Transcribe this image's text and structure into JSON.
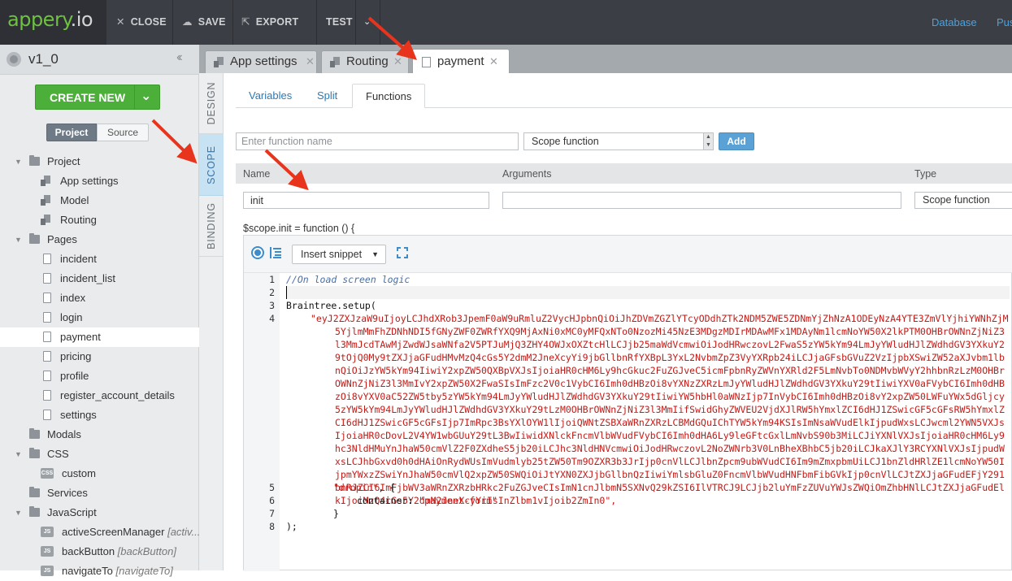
{
  "app": {
    "logo_main": "appery",
    "logo_suffix": ".io"
  },
  "toolbar": {
    "close_label": "CLOSE",
    "save_label": "SAVE",
    "export_label": "EXPORT",
    "test_label": "TEST",
    "database_link": "Database",
    "push_link": "Pus"
  },
  "project": {
    "name": "v1_0",
    "create_new_label": "CREATE NEW",
    "view_tabs": [
      "Project",
      "Source"
    ],
    "active_view": "Project"
  },
  "tree": [
    {
      "label": "Project",
      "type": "folder",
      "level": 0,
      "expanded": true
    },
    {
      "label": "App settings",
      "type": "config",
      "level": 1
    },
    {
      "label": "Model",
      "type": "config",
      "level": 1
    },
    {
      "label": "Routing",
      "type": "config",
      "level": 1
    },
    {
      "label": "Pages",
      "type": "folder",
      "level": 0,
      "expanded": true
    },
    {
      "label": "incident",
      "type": "page",
      "level": 1
    },
    {
      "label": "incident_list",
      "type": "page",
      "level": 1
    },
    {
      "label": "index",
      "type": "page",
      "level": 1
    },
    {
      "label": "login",
      "type": "page",
      "level": 1
    },
    {
      "label": "payment",
      "type": "page",
      "level": 1,
      "selected": true
    },
    {
      "label": "pricing",
      "type": "page",
      "level": 1
    },
    {
      "label": "profile",
      "type": "page",
      "level": 1
    },
    {
      "label": "register_account_details",
      "type": "page",
      "level": 1
    },
    {
      "label": "settings",
      "type": "page",
      "level": 1
    },
    {
      "label": "Modals",
      "type": "folder",
      "level": 0,
      "expanded": false
    },
    {
      "label": "CSS",
      "type": "folder",
      "level": 0,
      "expanded": true
    },
    {
      "label": "custom",
      "type": "css",
      "level": 1
    },
    {
      "label": "Services",
      "type": "folder",
      "level": 0,
      "expanded": false
    },
    {
      "label": "JavaScript",
      "type": "folder",
      "level": 0,
      "expanded": true
    },
    {
      "label": "activeScreenManager",
      "suffix": "[activ...",
      "type": "js",
      "level": 1
    },
    {
      "label": "backButton",
      "suffix": "[backButton]",
      "type": "js",
      "level": 1
    },
    {
      "label": "navigateTo",
      "suffix": "[navigateTo]",
      "type": "js",
      "level": 1
    }
  ],
  "vertical_tabs": [
    "DESIGN",
    "SCOPE",
    "BINDING"
  ],
  "active_vertical_tab": "SCOPE",
  "editor_tabs": [
    {
      "label": "App settings",
      "active": false
    },
    {
      "label": "Routing",
      "active": false
    },
    {
      "label": "payment",
      "active": true
    }
  ],
  "sub_tabs": [
    "Variables",
    "Split",
    "Functions"
  ],
  "active_sub_tab": "Functions",
  "new_function": {
    "name_placeholder": "Enter function name",
    "scope_value": "Scope function",
    "add_label": "Add"
  },
  "table": {
    "headers": [
      "Name",
      "Arguments",
      "Type"
    ],
    "row": {
      "name": "init",
      "arguments": "",
      "type": "Scope function"
    }
  },
  "signature": "$scope.init = function () {",
  "code_toolbar": {
    "snippet_label": "Insert snippet"
  },
  "code": {
    "line_numbers": [
      "1",
      "2",
      "3",
      "4",
      "5",
      "6",
      "7",
      "8"
    ],
    "line1": "//On load screen logic",
    "line3": "Braintree.setup(",
    "token": "\"eyJ2ZXJzaW9uIjoyLCJhdXRob3JpemF0aW9uRmluZ2VycHJpbnQiOiJhZDVmZGZlYTcyODdhZTk2NDM5ZWE5ZDNmYjZhNzA1ODEyNzA4YTE3ZmVlYjhiYWNhZjM5YjlmMmFhZDNhNDI5fGNyZWF0ZWRfYXQ9MjAxNi0xMC0yMFQxNTo0NzozMi45NzE3MDgzMDIrMDAwMFx1MDAyNm1lcmNoYW50X2lkPTM0OHBrOWNnZjNiZ3l3MmJcdTAwMjZwdWJsaWNfa2V5PTJuMjQ3ZHY4OWJxOXZtcHlLCJjb25maWdVcmwiOiJodHRwczovL2FwaS5zYW5kYm94LmJyYWludHJlZWdhdGV3YXkuY29tOjQ0My9tZXJjaGFudHMvMzQ4cGs5Y2dmM2JneXcyYi9jbGllbnRfYXBpL3YxL2NvbmZpZ3VyYXRpb24iLCJjaGFsbGVuZ2VzIjpbXSwiZW52aXJvbm1lbnQiOiJzYW5kYm94IiwiY2xpZW50QXBpVXJsIjoiaHR0cHM6Ly9hcGkuc2FuZGJveC5icmFpbnRyZWVnYXRld2F5LmNvbTo0NDMvbWVyY2hhbnRzLzM0OHBrOWNnZjNiZ3l3MmIvY2xpZW50X2FwaSIsImFzc2V0c1VybCI6Imh0dHBzOi8vYXNzZXRzLmJyYWludHJlZWdhdGV3YXkuY29tIiwiYXV0aFVybCI6Imh0dHBzOi8vYXV0aC52ZW5tby5zYW5kYm94LmJyYWludHJlZWdhdGV3YXkuY29tIiwiYW5hbHl0aWNzIjp7InVybCI6Imh0dHBzOi8vY2xpZW50LWFuYWx5dGljcy5zYW5kYm94LmJyYWludHJlZWdhdGV3YXkuY29tLzM0OHBrOWNnZjNiZ3l3MmIifSwidGhyZWVEU2VjdXJlRW5hYmxlZCI6dHJ1ZSwicGF5cGFsRW5hYmxlZCI6dHJ1ZSwicGF5cGFsIjp7ImRpc3BsYXlOYW1lIjoiQWNtZSBXaWRnZXRzLCBMdGQuIChTYW5kYm94KSIsImNsaWVudElkIjpudWxsLCJwcml2YWN5VXJsIjoiaHR0cDovL2V4YW1wbGUuY29tL3BwIiwidXNlckFncmVlbWVudFVybCI6Imh0dHA6Ly9leGFtcGxlLmNvbS90b3MiLCJiYXNlVXJsIjoiaHR0cHM6Ly9hc3NldHMuYnJhaW50cmVlZ2F0ZXdheS5jb20iLCJhc3NldHNVcmwiOiJodHRwczovL2NoZWNrb3V0LnBheXBhbC5jb20iLCJkaXJlY3RCYXNlVXJsIjpudWxsLCJhbGxvd0h0dHAiOnRydWUsImVudmlyb25tZW50Tm9OZXR3b3JrIjp0cnVlLCJlbnZpcm9ubWVudCI6Im9mZmxpbmUiLCJ1bnZldHRlZE1lcmNoYW50IjpmYWxzZSwiYnJhaW50cmVlQ2xpZW50SWQiOiJtYXN0ZXJjbGllbnQzIiwiYmlsbGluZ0FncmVlbWVudHNFbmFibGVkIjp0cnVlLCJtZXJjaGFudEFjY291bnRJZCI6ImFjbWV3aWRnZXRzbHRkc2FuZGJveCIsImN1cnJlbmN5SXNvQ29kZSI6IlVTRCJ9LCJjb2luYmFzZUVuYWJsZWQiOmZhbHNlLCJtZXJjaGFudElkIjoiMzQ4cGs5Y2dmM2JneXcyYiIsInZlbm1vIjoib2ZmIn0\",",
    "line5_key": "\"dropin\"",
    "line5_rest": ", {",
    "line6_key": "container: ",
    "line6_val": "\"payment-form\"",
    "line7": "}",
    "line8": ");"
  },
  "colors": {
    "accent_green": "#4caf3a",
    "accent_blue": "#5aa1d6",
    "annotation_red": "#e8341c"
  }
}
